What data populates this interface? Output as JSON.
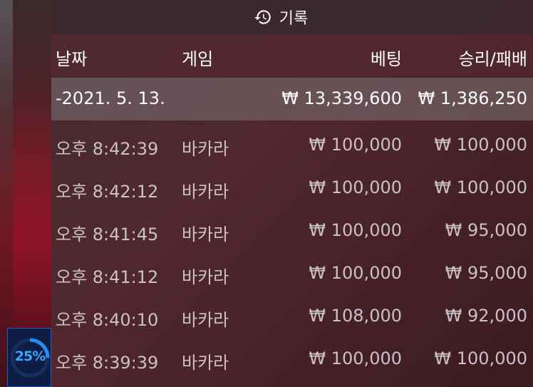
{
  "header": {
    "title": "기록",
    "icon": "history-icon"
  },
  "columns": {
    "date": "날짜",
    "game": "게임",
    "bet": "베팅",
    "win_loss": "승리/패배"
  },
  "summary": {
    "date": "-2021. 5. 13.",
    "bet": "₩ 13,339,600",
    "win_loss": "₩ 1,386,250"
  },
  "rows": [
    {
      "time": "오후 8:42:39",
      "game": "바카라",
      "bet": "₩ 100,000",
      "win_loss": "₩ 100,000"
    },
    {
      "time": "오후 8:42:12",
      "game": "바카라",
      "bet": "₩ 100,000",
      "win_loss": "₩ 100,000"
    },
    {
      "time": "오후 8:41:45",
      "game": "바카라",
      "bet": "₩ 100,000",
      "win_loss": "₩ 95,000"
    },
    {
      "time": "오후 8:41:12",
      "game": "바카라",
      "bet": "₩ 100,000",
      "win_loss": "₩ 95,000"
    },
    {
      "time": "오후 8:40:10",
      "game": "바카라",
      "bet": "₩ 108,000",
      "win_loss": "₩ 92,000"
    },
    {
      "time": "오후 8:39:39",
      "game": "바카라",
      "bet": "₩ 100,000",
      "win_loss": "₩ 100,000"
    }
  ],
  "progress": {
    "label": "25%",
    "value": 0.25
  },
  "colors": {
    "accent": "#37a8ff",
    "panel": "#522830"
  }
}
